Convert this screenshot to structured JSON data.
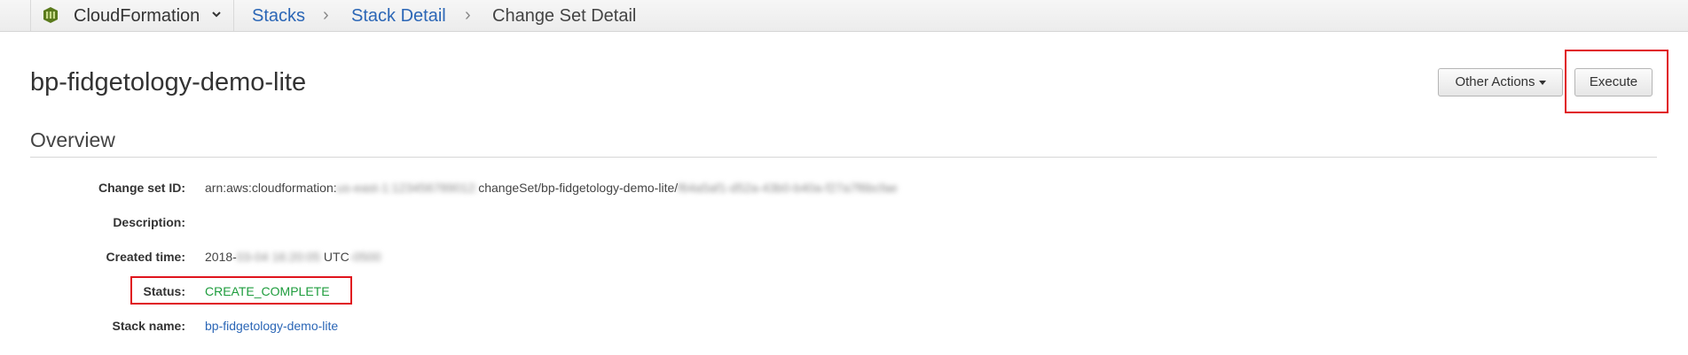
{
  "header": {
    "service_name": "CloudFormation",
    "service_icon": "cloudformation-icon",
    "breadcrumbs": [
      {
        "label": "Stacks"
      },
      {
        "label": "Stack Detail"
      },
      {
        "label": "Change Set Detail"
      }
    ],
    "separator": "›"
  },
  "page": {
    "title": "bp-fidgetology-demo-lite",
    "actions": {
      "other_actions_label": "Other Actions",
      "execute_label": "Execute"
    }
  },
  "overview": {
    "heading": "Overview",
    "rows": {
      "change_set_id": {
        "label": "Change set ID:",
        "value_prefix": "arn:aws:cloudformation:",
        "value_redacted_1": "us-east-1:123456789012:",
        "value_middle": "changeSet/bp-fidgetology-demo-lite/",
        "value_redacted_2": "f64a5af1-d52a-43b0-b40a-f27a7f6bcfae"
      },
      "description": {
        "label": "Description:",
        "value": ""
      },
      "created_time": {
        "label": "Created time:",
        "value_prefix": "2018-",
        "value_redacted_1": "03-04 16:20:05",
        "value_middle": " UTC",
        "value_redacted_2": "-0500"
      },
      "status": {
        "label": "Status:",
        "value": "CREATE_COMPLETE"
      },
      "stack_name": {
        "label": "Stack name:",
        "value": "bp-fidgetology-demo-lite"
      }
    }
  },
  "colors": {
    "link": "#2b66b6",
    "status_success": "#1d9c3c",
    "highlight": "#e0141d"
  }
}
